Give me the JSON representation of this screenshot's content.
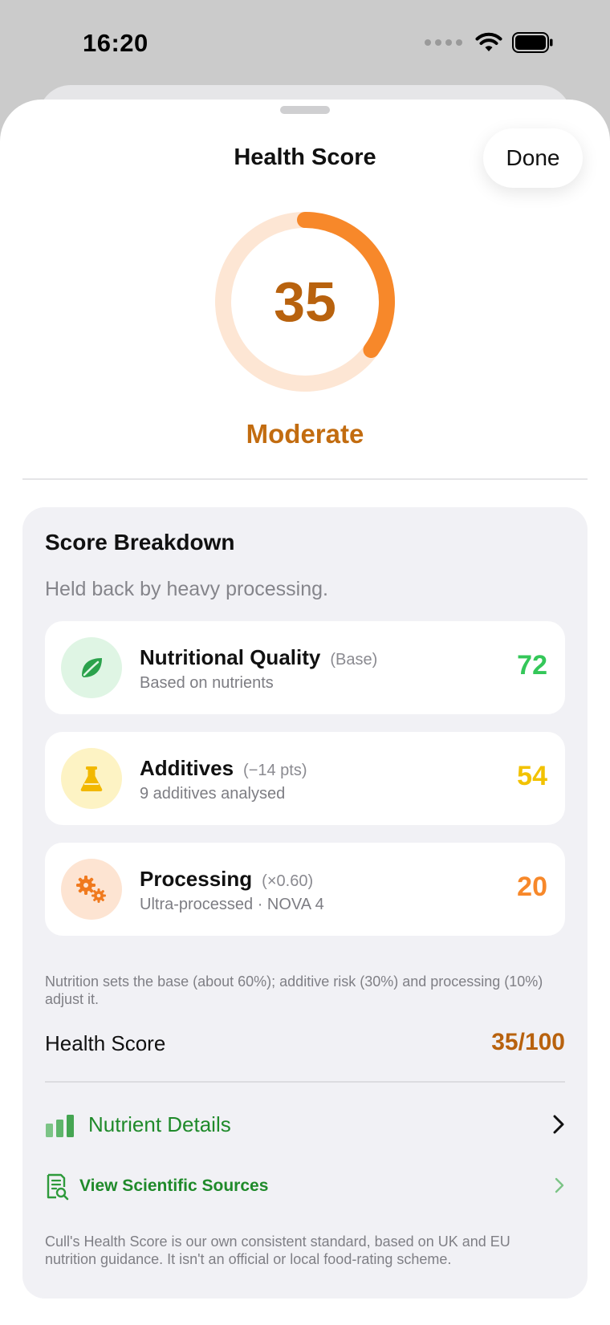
{
  "status": {
    "time": "16:20",
    "icons": [
      "signal-dots-icon",
      "wifi-icon",
      "battery-icon"
    ]
  },
  "sheet": {
    "title": "Health Score",
    "done_label": "Done"
  },
  "score": {
    "value": "35",
    "fraction": 0.35,
    "rating": "Moderate",
    "ring_color": "#f7882a",
    "track_color": "#fde6d4"
  },
  "breakdown": {
    "title": "Score Breakdown",
    "subtitle": "Held back by heavy processing.",
    "items": [
      {
        "name": "Nutritional Quality",
        "modifier": "(Base)",
        "description": "Based on nutrients",
        "value": "72",
        "color": "#34c759",
        "icon": "leaf-icon",
        "icon_bg": "#dff5e4"
      },
      {
        "name": "Additives",
        "modifier": "(−14 pts)",
        "description": "9 additives analysed",
        "value": "54",
        "color": "#f2c200",
        "icon": "flask-icon",
        "icon_bg": "#fdf3c4"
      },
      {
        "name": "Processing",
        "modifier": "(×0.60)",
        "description": "Ultra-processed · NOVA 4",
        "value": "20",
        "color": "#f7882a",
        "icon": "gears-icon",
        "icon_bg": "#fde4d2"
      }
    ],
    "note": "Nutrition sets the base (about 60%); additive risk (30%) and processing (10%) adjust it.",
    "total_label": "Health Score",
    "total_value": "35/100"
  },
  "links": {
    "nutrient_details": "Nutrient Details",
    "scientific_sources": "View Scientific Sources"
  },
  "footnote": "Cull's Health Score is our own consistent standard, based on UK and EU nutrition guidance. It isn't an official or local food-rating scheme."
}
